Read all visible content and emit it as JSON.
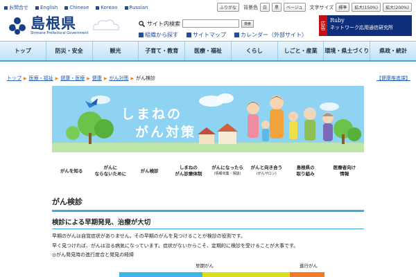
{
  "toplinks": [
    "お問合せ",
    "English",
    "Chinese",
    "Korean",
    "Russian"
  ],
  "utility": {
    "furigana": "ふりがな",
    "bg_label": "背景色",
    "bg_white": "白",
    "bg_black": "黒",
    "bg_beige": "ベージュ",
    "size_label": "文字サイズ",
    "size_standard": "標準",
    "size_150": "拡大(150%)",
    "size_200": "拡大(200%)"
  },
  "logo": {
    "title": "島根県",
    "subtitle": "Shimane Prefectural Government"
  },
  "search": {
    "label": "サイト内検索",
    "button": "検索",
    "placeholder": ""
  },
  "quicklinks": [
    "組織から探す",
    "サイトマップ",
    "カレンダー（外部サイト）"
  ],
  "ad": {
    "tag": "広告",
    "line1": "Ruby",
    "line2": "ネットワーク応用通信研究所"
  },
  "nav": [
    "トップ",
    "防災・安全",
    "観光",
    "子育て・教育",
    "医療・福祉",
    "くらし",
    "しごと・産業",
    "環境・県土づくり",
    "県政・統計"
  ],
  "breadcrumb": [
    "トップ",
    "医療・福祉",
    "健康・医療",
    "健康",
    "がん対策",
    "がん検診"
  ],
  "health_link": "【健康推進課】",
  "banner": {
    "title1": "しまねの",
    "title2": "がん対策"
  },
  "submenu": [
    {
      "l1": "がんを知る",
      "l2": "",
      "small": ""
    },
    {
      "l1": "がんに",
      "l2": "ならないために",
      "small": ""
    },
    {
      "l1": "がん検診",
      "l2": "",
      "small": ""
    },
    {
      "l1": "しまねの",
      "l2": "がん診療体制",
      "small": ""
    },
    {
      "l1": "がんになったら",
      "l2": "",
      "small": "(情報収集・相談)"
    },
    {
      "l1": "がんと向き合う",
      "l2": "",
      "small": "(がんサロン)"
    },
    {
      "l1": "島根県の",
      "l2": "取り組み",
      "small": ""
    },
    {
      "l1": "医療者向け",
      "l2": "情報",
      "small": ""
    }
  ],
  "content": {
    "heading": "がん検診",
    "subheading": "検診による早期発見、治療が大切",
    "para1": "早期のがんは自覚症状がありません。その早期のがんを見つけることが検診の役割です。",
    "para2": "早く見つければ、がんは治る病気になっています。症状がないからこそ、定期的に検診を受けることが大事です。",
    "para3": "◎がん発見時の進行度合と発見の経緯",
    "label_early": "早期がん",
    "label_advanced": "進行がん"
  },
  "colors": {
    "brand": "#173f86",
    "nav_border": "#4aa2db",
    "accent_orange": "#f08020",
    "bar_blue": "#3fb4e6",
    "bar_yellow": "#d8e020",
    "bar_orange": "#f07a2a"
  }
}
